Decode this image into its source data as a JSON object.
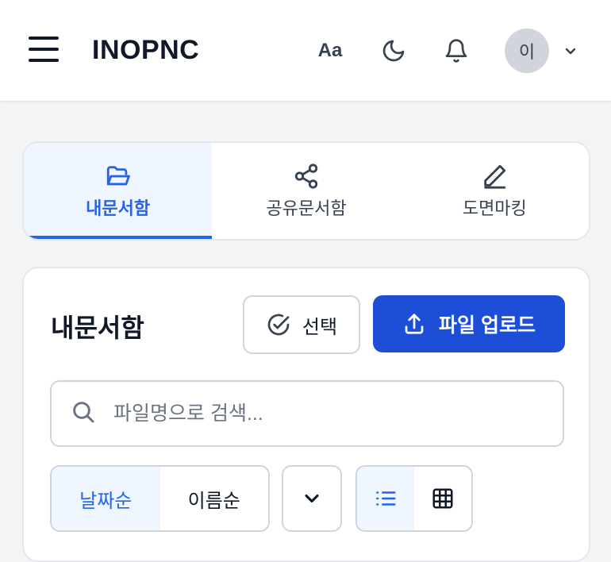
{
  "header": {
    "brand": "INOPNC",
    "font_size_label": "Aa",
    "avatar_initial": "이",
    "icons": [
      "menu-icon",
      "moon-icon",
      "bell-icon",
      "chevron-down-icon"
    ]
  },
  "tabs": [
    {
      "label": "내문서함",
      "icon": "folder-open-icon",
      "active": true
    },
    {
      "label": "공유문서함",
      "icon": "share-icon",
      "active": false
    },
    {
      "label": "도면마킹",
      "icon": "pencil-icon",
      "active": false
    }
  ],
  "main": {
    "title": "내문서함",
    "select_label": "선택",
    "upload_label": "파일 업로드",
    "search_placeholder": "파일명으로 검색...",
    "sort_options": [
      {
        "label": "날짜순",
        "active": true
      },
      {
        "label": "이름순",
        "active": false
      }
    ],
    "view_modes": [
      {
        "icon": "list-icon",
        "active": true
      },
      {
        "icon": "grid-icon",
        "active": false
      }
    ]
  },
  "colors": {
    "accent": "#2563eb",
    "upload_button": "#1d4ed8",
    "active_bg": "#eff6ff",
    "page_bg": "#f3f4f6"
  }
}
